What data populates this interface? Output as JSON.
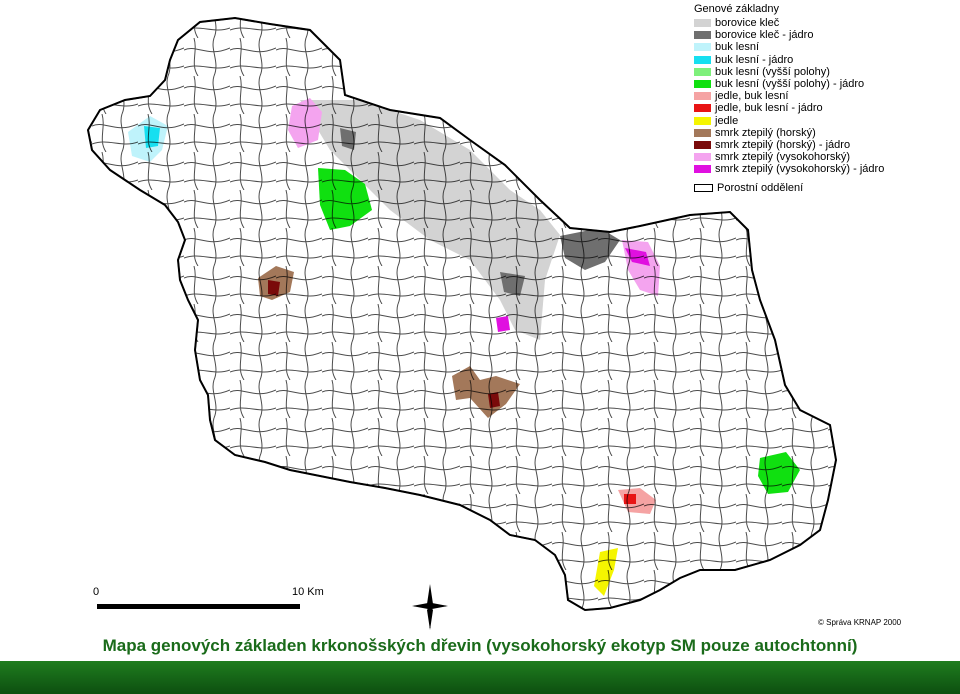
{
  "legend": {
    "title": "Genové základny",
    "items": [
      {
        "label": "borovice kleč",
        "color": "#d3d3d3"
      },
      {
        "label": "borovice kleč - jádro",
        "color": "#6f6f6f"
      },
      {
        "label": "buk lesní",
        "color": "#bff3fb"
      },
      {
        "label": "buk lesní - jádro",
        "color": "#16dff0"
      },
      {
        "label": "buk lesní (vyšší polohy)",
        "color": "#7ef07b"
      },
      {
        "label": "buk lesní (vyšší polohy) - jádro",
        "color": "#10e010"
      },
      {
        "label": "jedle, buk lesní",
        "color": "#f5a3a3"
      },
      {
        "label": "jedle, buk lesní - jádro",
        "color": "#e81414"
      },
      {
        "label": "jedle",
        "color": "#f5f500"
      },
      {
        "label": "smrk ztepilý (horský)",
        "color": "#a3785a"
      },
      {
        "label": "smrk ztepilý (horský) - jádro",
        "color": "#7a0a0a"
      },
      {
        "label": "smrk ztepilý (vysokohorský)",
        "color": "#f4a4ef"
      },
      {
        "label": "smrk ztepilý (vysokohorský) - jádro",
        "color": "#e010e0"
      }
    ],
    "border_label": "Porostní oddělení"
  },
  "scale": {
    "start": "0",
    "end": "10 Km"
  },
  "copyright": "© Správa KRNAP 2000",
  "caption": "Mapa genových základen krkonošských dřevin (vysokohorský ekotyp SM pouze autochtonní)",
  "colors": {
    "caption": "#1a6b1a",
    "band": "#1f7d1f"
  }
}
